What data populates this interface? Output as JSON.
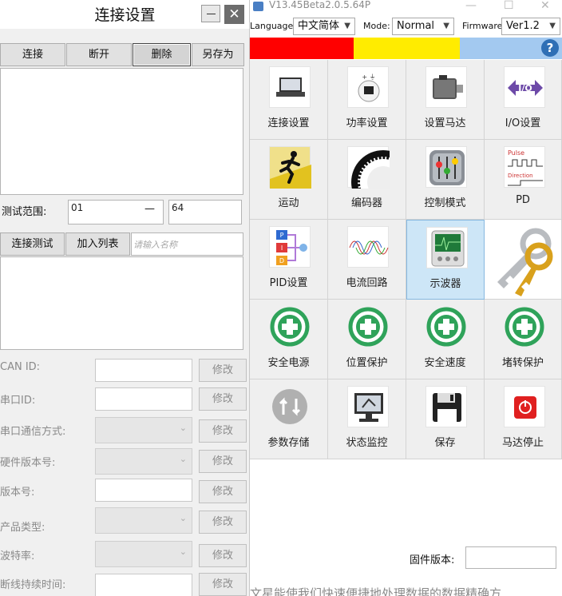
{
  "dialog": {
    "title": "连接设置",
    "close_glyph": "✕",
    "buttons": {
      "connect": "连接",
      "disconnect": "断开",
      "delete": "删除",
      "save_as": "另存为"
    },
    "range": {
      "label": "测试范围:",
      "from": "01",
      "dash": "—",
      "to": "64"
    },
    "test_buttons": {
      "connect_test": "连接测试",
      "add_to_list": "加入列表",
      "name_placeholder": "请输入名称"
    },
    "fields": [
      {
        "label": "CAN ID:",
        "kind": "input",
        "button": "修改"
      },
      {
        "label": "串口ID:",
        "kind": "input",
        "button": "修改"
      },
      {
        "label": "串口通信方式:",
        "kind": "select",
        "button": "修改"
      },
      {
        "label": "硬件版本号:",
        "kind": "select",
        "button": "修改"
      },
      {
        "label": "版本号:",
        "kind": "input",
        "button": "修改"
      },
      {
        "label": "产品类型:",
        "kind": "select",
        "button": "修改"
      },
      {
        "label": "波特率:",
        "kind": "select",
        "button": "修改"
      },
      {
        "label": "断线持续时间:",
        "kind": "input",
        "button": "修改"
      }
    ]
  },
  "main": {
    "title": "V13.45Beta2.0.5.64P",
    "window_controls": {
      "minimize": "—",
      "maximize": "☐",
      "close": "✕"
    },
    "toolbar": {
      "language_label": "Language:",
      "language_value": "中文简体",
      "mode_label": "Mode:",
      "mode_value": "Normal",
      "firmware_label": "Firmware:",
      "firmware_value": "Ver1.2",
      "help": "?"
    },
    "status_colors": [
      "#ff0000",
      "#ffec00",
      "#a3c9f0"
    ],
    "tiles": [
      {
        "label": "连接设置",
        "icon": "laptop-icon"
      },
      {
        "label": "功率设置",
        "icon": "power-supply-icon"
      },
      {
        "label": "设置马达",
        "icon": "motor-icon"
      },
      {
        "label": "I/O设置",
        "icon": "io-arrows-icon"
      },
      {
        "label": "运动",
        "icon": "runner-icon"
      },
      {
        "label": "编码器",
        "icon": "encoder-disk-icon"
      },
      {
        "label": "控制模式",
        "icon": "mixer-icon"
      },
      {
        "label": "PD",
        "icon": "pulse-direction-icon"
      },
      {
        "label": "PID设置",
        "icon": "pid-icon"
      },
      {
        "label": "电流回路",
        "icon": "sine-waves-icon"
      },
      {
        "label": "示波器",
        "icon": "oscilloscope-icon",
        "selected": true
      },
      {
        "label": "",
        "icon": "key-icon"
      },
      {
        "label": "安全电源",
        "icon": "green-cross-icon"
      },
      {
        "label": "位置保护",
        "icon": "green-cross-icon"
      },
      {
        "label": "安全速度",
        "icon": "green-cross-icon"
      },
      {
        "label": "堵转保护",
        "icon": "green-cross-icon"
      },
      {
        "label": "参数存储",
        "icon": "store-arrows-icon"
      },
      {
        "label": "状态监控",
        "icon": "monitor-icon"
      },
      {
        "label": "保存",
        "icon": "floppy-icon"
      },
      {
        "label": "马达停止",
        "icon": "stop-icon"
      }
    ],
    "firmware_version_label": "固件版本:",
    "bottom_text": "文星能使我们快速便捷地处理数据的数据精确方"
  }
}
